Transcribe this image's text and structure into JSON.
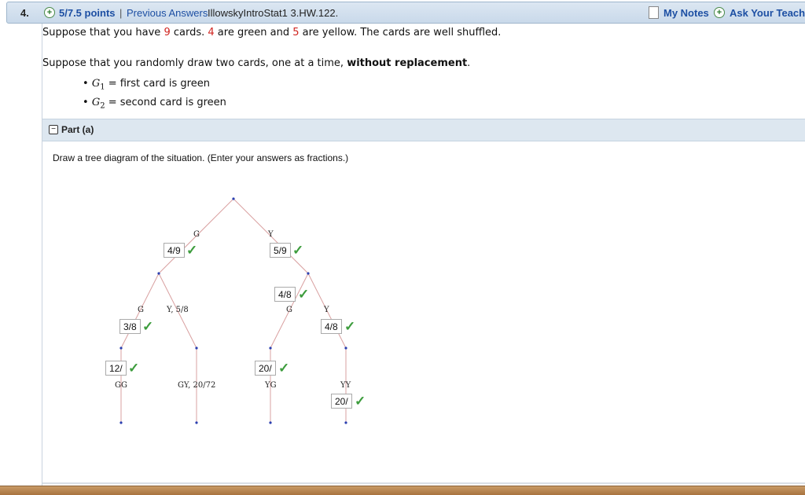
{
  "header": {
    "question_number": "4.",
    "points": "5/7.5 points",
    "separator": "|",
    "previous_answers": "Previous Answers",
    "assignment_code": "IllowskyIntroStat1 3.HW.122.",
    "my_notes": "My Notes",
    "ask_teacher": "Ask Your Teacher",
    "plus_symbol": "+"
  },
  "problem": {
    "p1_a": "Suppose that you have ",
    "p1_n1": "9",
    "p1_b": " cards. ",
    "p1_n2": "4",
    "p1_c": " are green and ",
    "p1_n3": "5",
    "p1_d": " are yellow. The cards are well shuffled.",
    "p2_a": "Suppose that you randomly draw two cards, one at a time, ",
    "p2_bold": "without replacement",
    "p2_end": ".",
    "bullet_char": "•",
    "g1_var": "G",
    "g1_sub": "1",
    "g1_text": " = first card is green",
    "g2_var": "G",
    "g2_sub": "2",
    "g2_text": " = second card is green"
  },
  "part": {
    "toggle": "−",
    "label": "Part (a)",
    "instructions": "Draw a tree diagram of the situation. (Enter your answers as fractions.)"
  },
  "tree": {
    "labels": {
      "G_top": "G",
      "Y_top": "Y",
      "G_left": "G",
      "Y_left": "Y, 5/8",
      "G_right": "G",
      "Y_right": "Y",
      "GG": "GG",
      "GY": "GY, 20/72",
      "YG": "YG",
      "YY": "YY"
    },
    "answers": {
      "a_first_g": "4/9",
      "a_first_y": "5/9",
      "a_right_g": "4/8",
      "a_left_g": "3/8",
      "a_right_y": "4/8",
      "a_gg": "12/",
      "a_yg": "20/",
      "a_yy": "20/"
    },
    "check_mark": "✓",
    "colors": {
      "branch": "#d9a0a0",
      "dot": "#2a3fb0",
      "check": "#3c9c3c"
    }
  }
}
